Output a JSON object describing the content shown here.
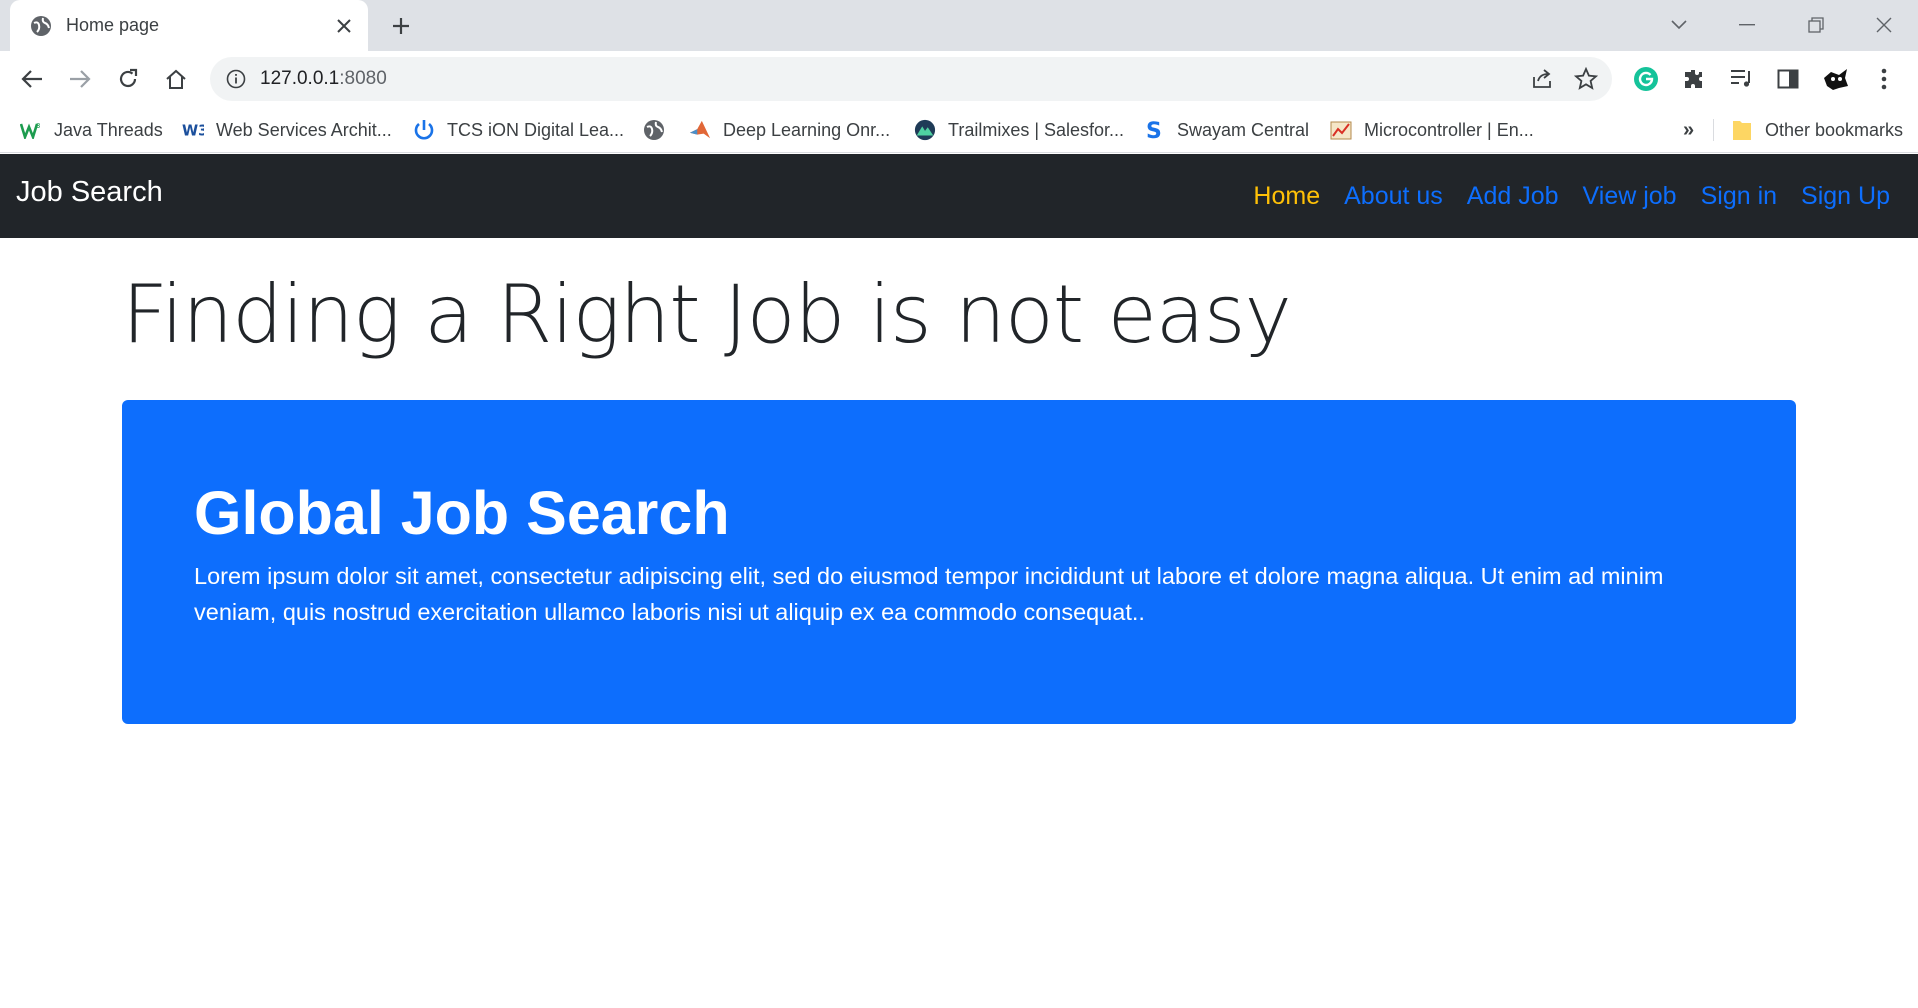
{
  "browser": {
    "tab_title": "Home page",
    "url_host": "127.0.0.1",
    "url_port": ":8080",
    "bookmarks": [
      {
        "label": "Java Threads",
        "icon": "w3-icon"
      },
      {
        "label": "Web Services Archit...",
        "icon": "w3c-icon"
      },
      {
        "label": "TCS iON Digital Lea...",
        "icon": "power-icon"
      },
      {
        "label": "",
        "icon": "globe-icon"
      },
      {
        "label": "Deep Learning Onr...",
        "icon": "matlab-icon"
      },
      {
        "label": "Trailmixes | Salesfor...",
        "icon": "trailhead-icon"
      },
      {
        "label": "Swayam Central",
        "icon": "swayam-icon"
      },
      {
        "label": "Microcontroller | En...",
        "icon": "chart-icon"
      }
    ],
    "more_bookmarks": "»",
    "other_bookmarks": "Other bookmarks"
  },
  "navbar": {
    "brand": "Job Search",
    "links": [
      "Home",
      "About us",
      "Add Job",
      "View job",
      "Sign in",
      "Sign Up"
    ],
    "active_color": "#ffc107",
    "link_color": "#0d6efd"
  },
  "main": {
    "headline": "Finding a Right Job is not easy",
    "card": {
      "heading": "Global Job Search",
      "text": "Lorem ipsum dolor sit amet, consectetur adipiscing elit, sed do eiusmod tempor incididunt ut labore et dolore magna aliqua. Ut enim ad minim veniam, quis nostrud exercitation ullamco laboris nisi ut aliquip ex ea commodo consequat..",
      "background": "#0d6efd"
    }
  }
}
